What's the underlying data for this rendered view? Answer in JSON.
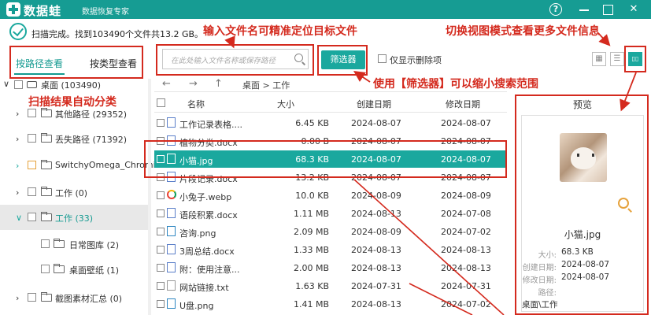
{
  "titlebar": {
    "app_name": "数据蛙",
    "subtitle": "数据恢复专家",
    "help": "?",
    "min": "",
    "max": "",
    "close": "✕"
  },
  "status": {
    "text": "扫描完成。找到103490个文件共13.2 GB。"
  },
  "annotations": {
    "input_name": "输入文件名可精准定位目标文件",
    "switch_view": "切换视图模式查看更多文件信息",
    "auto_classify": "扫描结果自动分类",
    "use_filter": "使用【筛选器】可以缩小搜索范围"
  },
  "left_tabs": {
    "by_path": "按路径查看",
    "by_type": "按类型查看"
  },
  "tree": [
    {
      "label": "桌面 (103490)",
      "chev": "∨"
    },
    {
      "label": "其他路径 (29352)",
      "chev": "›"
    },
    {
      "label": "丢失路径 (71392)",
      "chev": "›"
    },
    {
      "label": "SwitchyOmega_Chromiu",
      "chev": "›"
    },
    {
      "label": "工作 (0)",
      "chev": "›"
    },
    {
      "label": "工作 (33)",
      "chev": "∨"
    },
    {
      "label": "日常图库 (2)",
      "chev": ""
    },
    {
      "label": "桌面壁纸 (1)",
      "chev": ""
    },
    {
      "label": "截图素材汇总 (0)",
      "chev": "›"
    }
  ],
  "toolbar": {
    "search_placeholder": "在此处输入文件名称或保存路径",
    "filter_label": "筛选器",
    "show_deleted": "仅显示删除项",
    "view_grid": "▦",
    "view_list": "☰",
    "view_detail": "▯▯"
  },
  "nav": {
    "back": "←",
    "forward": "→",
    "up": "↑",
    "breadcrumb": "桌面 > 工作"
  },
  "table": {
    "headers": {
      "name": "名称",
      "size": "大小",
      "created": "创建日期",
      "modified": "修改日期"
    },
    "rows": [
      {
        "name": "工作记录表格....",
        "size": "6.45 KB",
        "created": "2024-08-07",
        "modified": "2024-08-07",
        "icon": "doc-icon"
      },
      {
        "name": "植物分类.docx",
        "size": "0.00 B",
        "created": "2024-08-07",
        "modified": "2024-08-07",
        "icon": "doc-icon"
      },
      {
        "name": "小猫.jpg",
        "size": "68.3 KB",
        "created": "2024-08-07",
        "modified": "2024-08-07",
        "icon": "image-icon"
      },
      {
        "name": "片段记录.docx",
        "size": "13.2 KB",
        "created": "2024-08-07",
        "modified": "2024-08-07",
        "icon": "doc-icon"
      },
      {
        "name": "小兔子.webp",
        "size": "10.0 KB",
        "created": "2024-08-09",
        "modified": "2024-08-09",
        "icon": "web-icon"
      },
      {
        "name": "语段积累.docx",
        "size": "1.11 MB",
        "created": "2024-08-13",
        "modified": "2024-07-08",
        "icon": "doc-icon"
      },
      {
        "name": "咨询.png",
        "size": "2.09 MB",
        "created": "2024-08-09",
        "modified": "2024-07-02",
        "icon": "image-icon"
      },
      {
        "name": "3周总结.docx",
        "size": "1.33 MB",
        "created": "2024-08-13",
        "modified": "2024-08-13",
        "icon": "doc-icon"
      },
      {
        "name": "附：使用注意...",
        "size": "2.00 MB",
        "created": "2024-08-13",
        "modified": "2024-08-13",
        "icon": "doc-icon"
      },
      {
        "name": "网站链接.txt",
        "size": "1.63 KB",
        "created": "2024-07-31",
        "modified": "2024-07-31",
        "icon": "text-icon"
      },
      {
        "name": "U盘.png",
        "size": "1.41 MB",
        "created": "2024-08-13",
        "modified": "2024-07-02",
        "icon": "image-icon"
      }
    ]
  },
  "preview": {
    "title": "预览",
    "file_name": "小猫.jpg",
    "size_label": "大小:",
    "size": "68.3 KB",
    "created_label": "创建日期:",
    "created": "2024-08-07",
    "modified_label": "修改日期:",
    "modified": "2024-08-07",
    "path_label": "路径:",
    "path": "桌面\\工作"
  },
  "colors": {
    "accent": "#1aa89e",
    "annotation": "#d42a1e"
  }
}
